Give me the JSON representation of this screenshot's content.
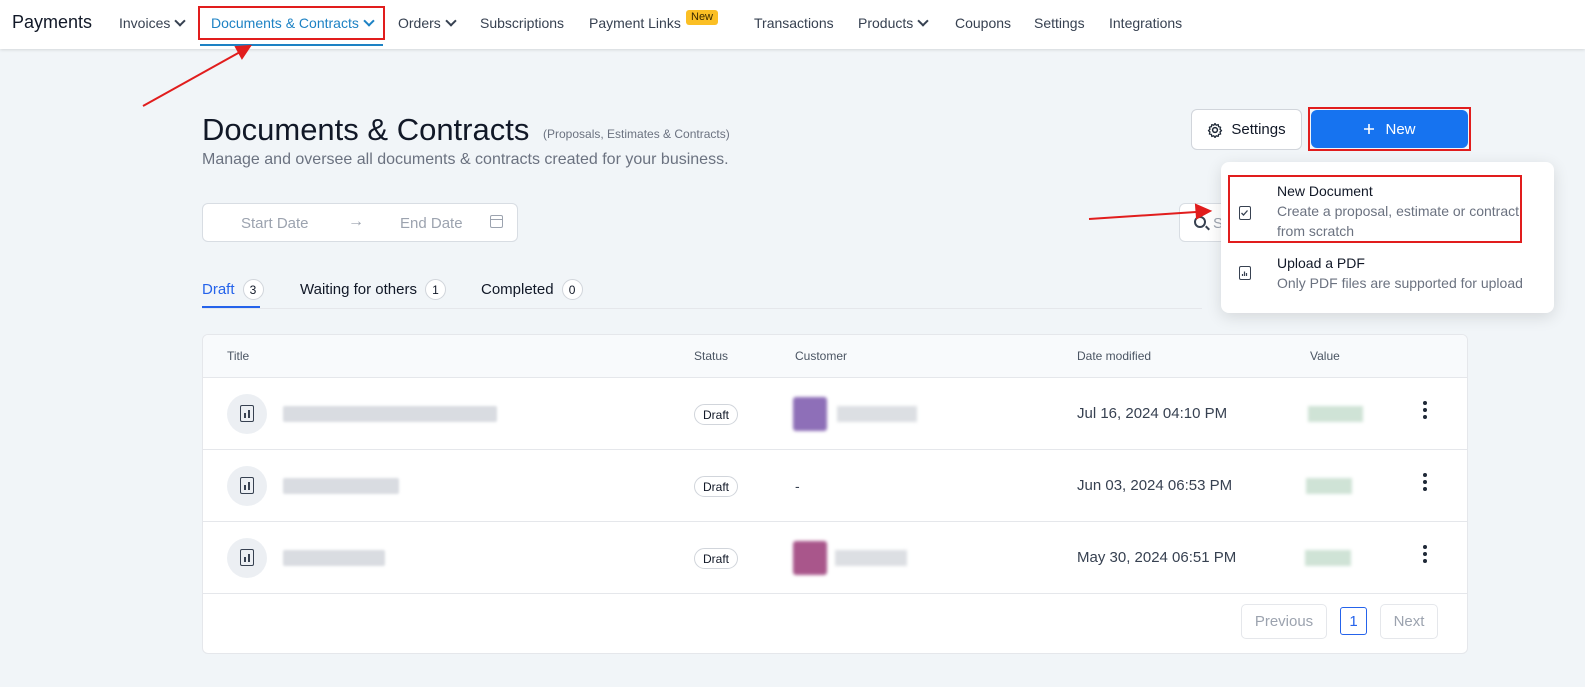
{
  "nav": {
    "brand": "Payments",
    "items": [
      {
        "label": "Invoices"
      },
      {
        "label": "Documents & Contracts"
      },
      {
        "label": "Orders"
      },
      {
        "label": "Subscriptions"
      },
      {
        "label": "Payment Links"
      },
      {
        "label": "Transactions"
      },
      {
        "label": "Products"
      },
      {
        "label": "Coupons"
      },
      {
        "label": "Settings"
      },
      {
        "label": "Integrations"
      }
    ],
    "new_badge": "New"
  },
  "header": {
    "title": "Documents & Contracts",
    "hint": "(Proposals, Estimates & Contracts)",
    "subtitle": "Manage and oversee all documents & contracts created for your business.",
    "settings_label": "Settings",
    "new_label": "New"
  },
  "filters": {
    "start_date_placeholder": "Start Date",
    "arrow": "→",
    "end_date_placeholder": "End Date",
    "search_partial": "S"
  },
  "tabs": [
    {
      "label": "Draft",
      "count": "3"
    },
    {
      "label": "Waiting for others",
      "count": "1"
    },
    {
      "label": "Completed",
      "count": "0"
    }
  ],
  "table": {
    "columns": [
      "Title",
      "Status",
      "Customer",
      "Date modified",
      "Value"
    ],
    "rows": [
      {
        "status": "Draft",
        "customer": "",
        "date": "Jul 16, 2024 04:10 PM"
      },
      {
        "status": "Draft",
        "customer": "-",
        "date": "Jun 03, 2024 06:53 PM"
      },
      {
        "status": "Draft",
        "customer": "",
        "date": "May 30, 2024 06:51 PM"
      }
    ]
  },
  "pagination": {
    "previous": "Previous",
    "current": "1",
    "next": "Next"
  },
  "dropdown": {
    "items": [
      {
        "title": "New Document",
        "desc": "Create a proposal, estimate or contract from scratch"
      },
      {
        "title": "Upload a PDF",
        "desc": "Only PDF files are supported for upload"
      }
    ]
  },
  "colors": {
    "accent": "#1d82c4",
    "primary_button": "#1673f0",
    "highlight": "#e11d1d"
  },
  "icons": [
    "chevron-down-icon",
    "gear-icon",
    "plus-icon",
    "calendar-icon",
    "search-icon",
    "document-icon",
    "kebab-icon",
    "checklist-icon",
    "pdf-icon"
  ]
}
